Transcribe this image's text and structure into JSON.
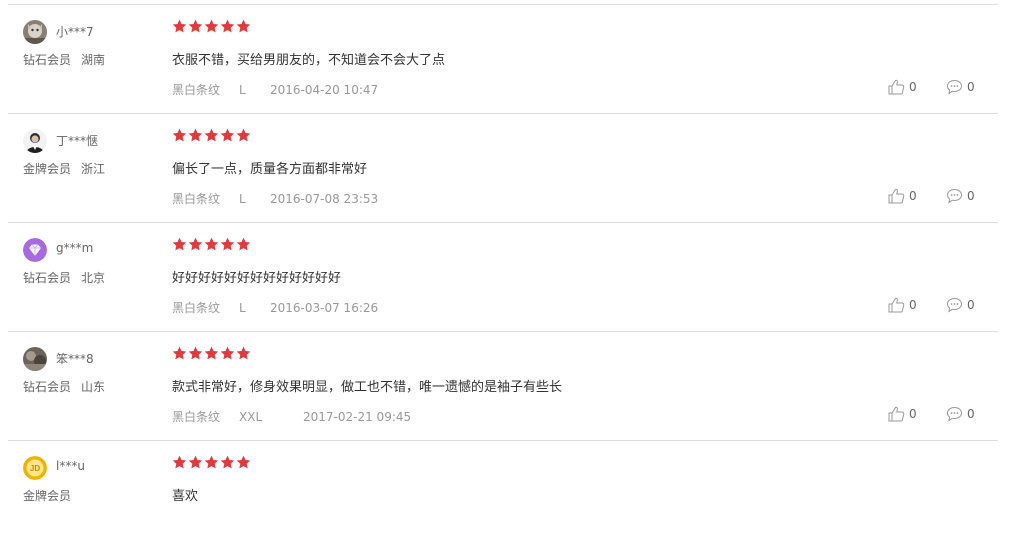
{
  "colors": {
    "star": "#e4393c",
    "divider": "#dddddd",
    "meta_text": "#999999",
    "user_text": "#666666"
  },
  "icons": {
    "rating": "star-icon",
    "like": "thumbs-up-icon",
    "reply": "comment-bubble-icon"
  },
  "reviews": [
    {
      "username": "小***7",
      "avatar": "cat-photo-avatar",
      "level": "钻石会员",
      "region": "湖南",
      "rating": 5,
      "content": "衣服不错，买给男朋友的，不知道会不会大了点",
      "color": "黑白条纹",
      "size": "L",
      "date": "2016-04-20 10:47",
      "likes": "0",
      "replies": "0"
    },
    {
      "username": "丁***惬",
      "avatar": "man-photo-avatar",
      "level": "金牌会员",
      "region": "浙江",
      "rating": 5,
      "content": "偏长了一点，质量各方面都非常好",
      "color": "黑白条纹",
      "size": "L",
      "date": "2016-07-08 23:53",
      "likes": "0",
      "replies": "0"
    },
    {
      "username": "g***m",
      "avatar": "diamond-avatar",
      "level": "钻石会员",
      "region": "北京",
      "rating": 5,
      "content": "好好好好好好好好好好好好好",
      "color": "黑白条纹",
      "size": "L",
      "date": "2016-03-07 16:26",
      "likes": "0",
      "replies": "0"
    },
    {
      "username": "笨***8",
      "avatar": "photo-avatar",
      "level": "钻石会员",
      "region": "山东",
      "rating": 5,
      "content": "款式非常好，修身效果明显，做工也不错，唯一遗憾的是袖子有些长",
      "color": "黑白条纹",
      "size": "XXL",
      "date": "2017-02-21 09:45",
      "likes": "0",
      "replies": "0"
    },
    {
      "username": "l***u",
      "avatar": "jd-gold-avatar",
      "level": "金牌会员",
      "region": "",
      "rating": 5,
      "content": "喜欢"
    }
  ]
}
